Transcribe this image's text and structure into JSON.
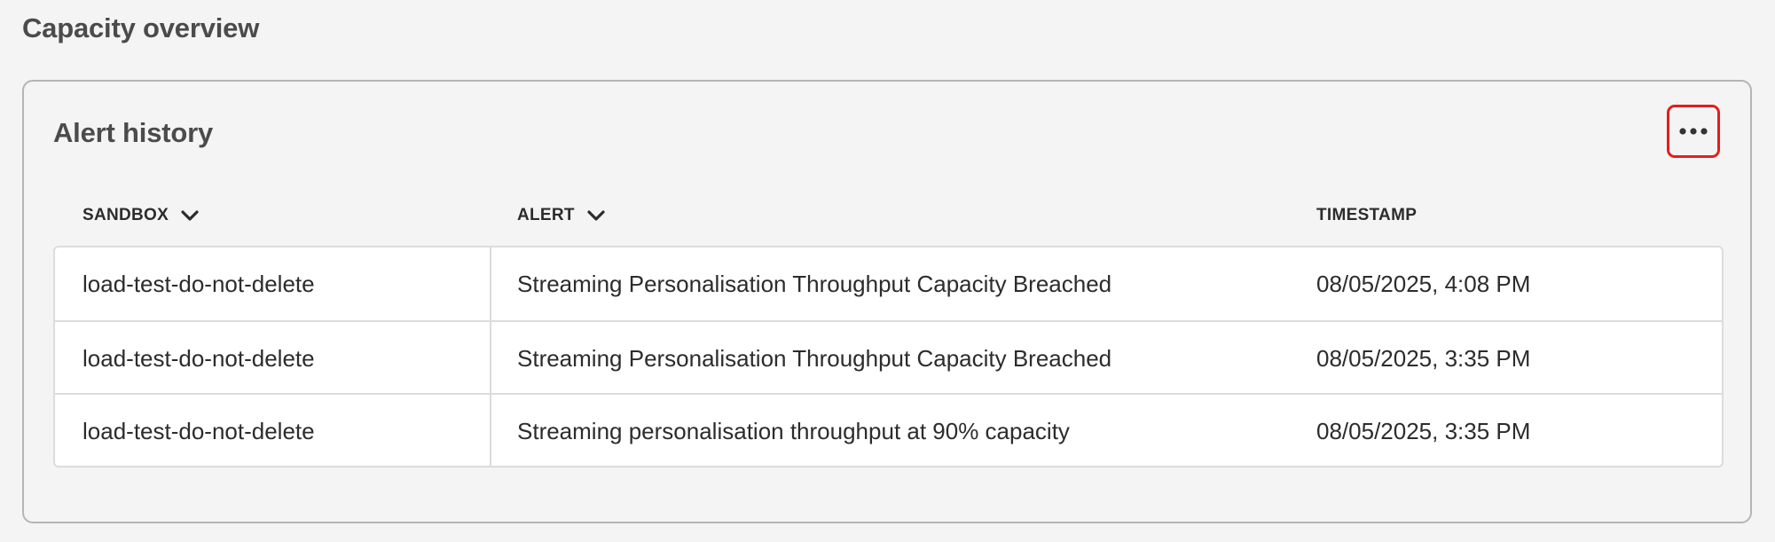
{
  "page": {
    "title": "Capacity overview"
  },
  "card": {
    "title": "Alert history",
    "more_icon": "more-horizontal-icon",
    "highlight_color": "#e31e1e"
  },
  "table": {
    "columns": [
      {
        "label": "SANDBOX",
        "sortable_icon": "chevron-down-icon"
      },
      {
        "label": "ALERT",
        "sortable_icon": "chevron-down-icon"
      },
      {
        "label": "TIMESTAMP"
      }
    ],
    "rows": [
      {
        "sandbox": "load-test-do-not-delete",
        "alert": "Streaming Personalisation Throughput Capacity Breached",
        "timestamp": "08/05/2025, 4:08 PM"
      },
      {
        "sandbox": "load-test-do-not-delete",
        "alert": "Streaming Personalisation Throughput Capacity Breached",
        "timestamp": "08/05/2025, 3:35 PM"
      },
      {
        "sandbox": "load-test-do-not-delete",
        "alert": "Streaming personalisation throughput at 90% capacity",
        "timestamp": "08/05/2025, 3:35 PM"
      }
    ]
  }
}
